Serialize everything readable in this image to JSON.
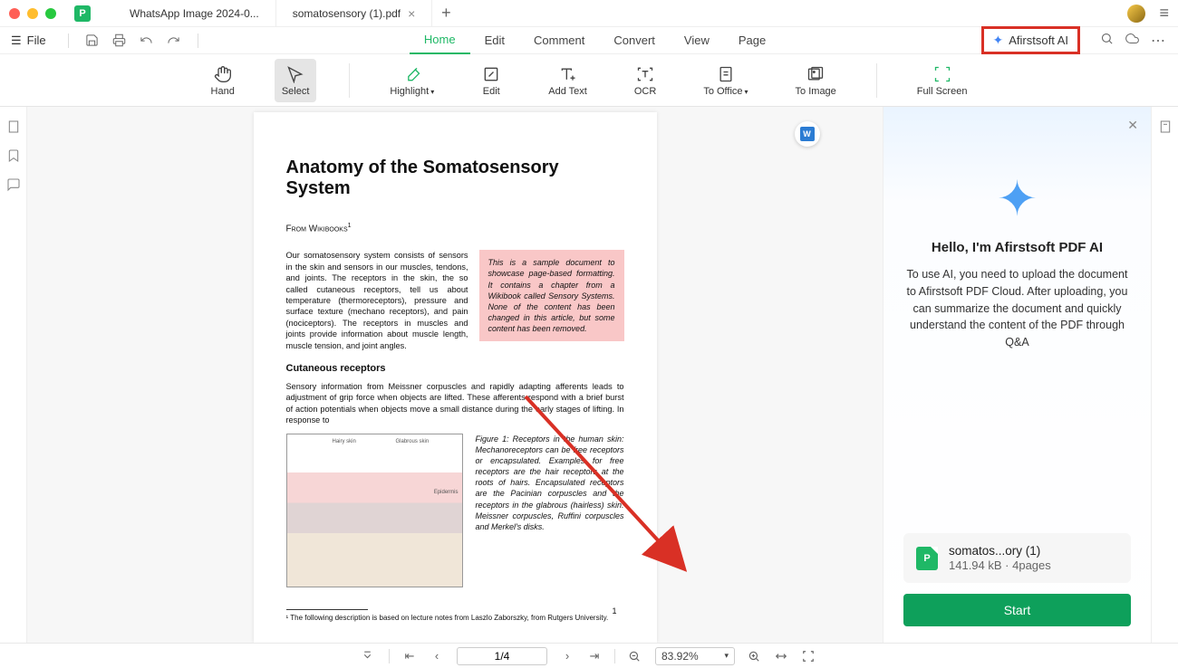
{
  "tabs": [
    {
      "label": "WhatsApp Image 2024-0...",
      "active": false,
      "closable": false
    },
    {
      "label": "somatosensory (1).pdf",
      "active": true,
      "closable": true
    }
  ],
  "fileMenu": "File",
  "mainTabs": [
    "Home",
    "Edit",
    "Comment",
    "Convert",
    "View",
    "Page"
  ],
  "activeMainTab": "Home",
  "aiButtonLabel": "Afirstsoft AI",
  "toolbar": {
    "hand": "Hand",
    "select": "Select",
    "highlight": "Highlight",
    "edit": "Edit",
    "addText": "Add Text",
    "ocr": "OCR",
    "toOffice": "To Office",
    "toImage": "To Image",
    "fullScreen": "Full Screen"
  },
  "document": {
    "title": "Anatomy of the Somatosensory System",
    "byline": "From Wikibooks",
    "para1": "Our somatosensory system consists of sensors in the skin and sensors in our muscles, tendons, and joints. The receptors in the skin, the so called cutaneous receptors, tell us about temperature (thermoreceptors), pressure and surface texture (mechano receptors), and pain (nociceptors). The receptors in muscles and joints provide information about muscle length, muscle tension, and joint angles.",
    "note": "This is a sample document to showcase page-based formatting. It contains a chapter from a Wikibook called Sensory Systems. None of the content has been changed in this article, but some content has been removed.",
    "subhead": "Cutaneous receptors",
    "para2": "Sensory information from Meissner corpuscles and rapidly adapting afferents leads to adjustment of grip force when objects are lifted. These afferents respond with a brief burst of action potentials when objects move a small distance during the early stages of lifting. In response to",
    "figCaption": "Figure 1: Receptors in the human skin: Mechanoreceptors can be free receptors or encapsulated. Examples for free receptors are the hair receptors at the roots of hairs. Encapsulated receptors are the Pacinian corpuscles and the receptors in the glabrous (hairless) skin: Meissner corpuscles, Ruffini corpuscles and Merkel's disks.",
    "footnote": "¹ The following description is based on lecture notes from Laszlo Zaborszky, from Rutgers University.",
    "pageNum": "1"
  },
  "aiPanel": {
    "title": "Hello, I'm Afirstsoft PDF AI",
    "description": "To use AI, you need to upload the document to Afirstsoft PDF Cloud. After uploading, you can summarize the document and quickly understand the content of the PDF through Q&A",
    "fileName": "somatos...ory (1)",
    "fileSize": "141.94 kB",
    "filePages": "4pages",
    "startLabel": "Start"
  },
  "statusBar": {
    "pageIndicator": "1/4",
    "zoom": "83.92%"
  }
}
